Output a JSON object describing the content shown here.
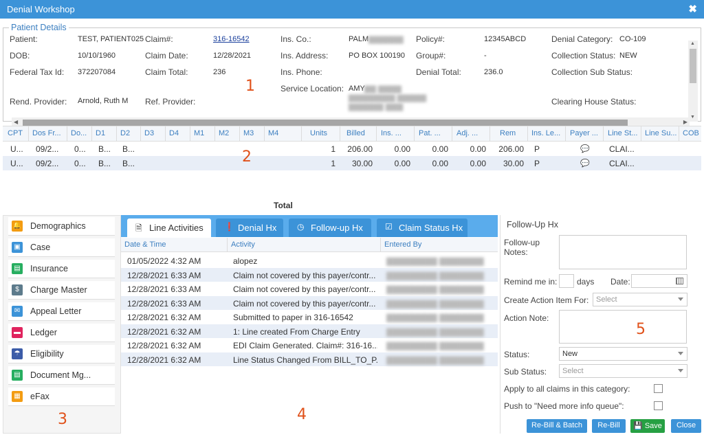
{
  "window": {
    "title": "Denial Workshop",
    "close_icon": "close-icon"
  },
  "markers": [
    "1",
    "2",
    "3",
    "4",
    "5"
  ],
  "patient_details": {
    "legend": "Patient Details",
    "labels": {
      "patient": "Patient:",
      "claim": "Claim#:",
      "ins_co": "Ins. Co.:",
      "policy": "Policy#:",
      "denial_category": "Denial Category:",
      "dob": "DOB:",
      "claim_date": "Claim Date:",
      "ins_address": "Ins. Address:",
      "group": "Group#:",
      "collection_status": "Collection Status:",
      "federal_tax_id": "Federal Tax Id:",
      "claim_total": "Claim Total:",
      "ins_phone": "Ins. Phone:",
      "denial_total": "Denial Total:",
      "collection_sub_status": "Collection Sub Status:",
      "service_location": "Service Location:",
      "rend_provider": "Rend. Provider:",
      "ref_provider": "Ref. Provider:",
      "clearing_house_status": "Clearing House Status:"
    },
    "values": {
      "patient": "TEST, PATIENT025",
      "claim": "316-16542",
      "ins_co": "PALM",
      "policy": "12345ABCD",
      "denial_category": "CO-109",
      "dob": "10/10/1960",
      "claim_date": "12/28/2021",
      "ins_address": "PO BOX 100190",
      "group": "-",
      "collection_status": "NEW",
      "federal_tax_id": "372207084",
      "claim_total": "236",
      "denial_total": "236.0",
      "service_location": "AMY",
      "rend_provider": "Arnold, Ruth M"
    }
  },
  "charge_grid": {
    "columns": [
      "CPT",
      "Dos Fr...",
      "Do...",
      "D1",
      "D2",
      "D3",
      "D4",
      "M1",
      "M2",
      "M3",
      "M4",
      "Units",
      "Billed",
      "Ins. ...",
      "Pat. ...",
      "Adj. ...",
      "Rem",
      "Ins. Le...",
      "Payer ...",
      "Line St...",
      "Line Su...",
      "COB"
    ],
    "rows": [
      {
        "cpt": "U...",
        "dos_from": "09/2...",
        "dos_to": "0...",
        "d1": "B...",
        "d2": "B...",
        "units": "1",
        "billed": "206.00",
        "ins": "0.00",
        "pat": "0.00",
        "adj": "0.00",
        "rem": "206.00",
        "ins_level": "P",
        "payer_icon": "comment-icon",
        "line_status": "CLAI..."
      },
      {
        "cpt": "U...",
        "dos_from": "09/2...",
        "dos_to": "0...",
        "d1": "B...",
        "d2": "B...",
        "units": "1",
        "billed": "30.00",
        "ins": "0.00",
        "pat": "0.00",
        "adj": "0.00",
        "rem": "30.00",
        "ins_level": "P",
        "payer_icon": "comment-icon",
        "line_status": "CLAI..."
      }
    ],
    "total_label": "Total"
  },
  "sidebar": {
    "items": [
      {
        "label": "Demographics",
        "icon": "bell-icon",
        "color": "#f39c12"
      },
      {
        "label": "Case",
        "icon": "case-icon",
        "color": "#3c93d8"
      },
      {
        "label": "Insurance",
        "icon": "id-card-icon",
        "color": "#27ae60"
      },
      {
        "label": "Charge Master",
        "icon": "dollar-icon",
        "color": "#5d7b8c"
      },
      {
        "label": "Appeal Letter",
        "icon": "envelope-icon",
        "color": "#3c93d8"
      },
      {
        "label": "Ledger",
        "icon": "ledger-icon",
        "color": "#e0245e"
      },
      {
        "label": "Eligibility",
        "icon": "umbrella-icon",
        "color": "#3c5ca8"
      },
      {
        "label": "Document Mg...",
        "icon": "document-icon",
        "color": "#27ae60"
      },
      {
        "label": "eFax",
        "icon": "fax-icon",
        "color": "#f39c12"
      }
    ]
  },
  "activity": {
    "tabs": [
      {
        "label": "Line Activities",
        "icon": "file-icon",
        "active": true
      },
      {
        "label": "Denial Hx",
        "icon": "alert-icon",
        "active": false
      },
      {
        "label": "Follow-up Hx",
        "icon": "clock-icon",
        "active": false
      },
      {
        "label": "Claim Status Hx",
        "icon": "check-square-icon",
        "active": false
      }
    ],
    "columns": [
      "Date & Time",
      "Activity",
      "Entered By"
    ],
    "rows": [
      {
        "datetime": "01/05/2022 4:32 AM",
        "activity": "alopez",
        "entered_by": ""
      },
      {
        "datetime": "12/28/2021 6:33 AM",
        "activity": "Claim not covered by this payer/contr...",
        "entered_by": ""
      },
      {
        "datetime": "12/28/2021 6:33 AM",
        "activity": "Claim not covered by this payer/contr...",
        "entered_by": ""
      },
      {
        "datetime": "12/28/2021 6:33 AM",
        "activity": "Claim not covered by this payer/contr...",
        "entered_by": ""
      },
      {
        "datetime": "12/28/2021 6:32 AM",
        "activity": "Submitted to paper in 316-16542",
        "entered_by": ""
      },
      {
        "datetime": "12/28/2021 6:32 AM",
        "activity": "1: Line created From Charge Entry",
        "entered_by": ""
      },
      {
        "datetime": "12/28/2021 6:32 AM",
        "activity": "EDI Claim Generated. Claim#: 316-16...",
        "entered_by": ""
      },
      {
        "datetime": "12/28/2021 6:32 AM",
        "activity": "Line Status Changed From BILL_TO_P...",
        "entered_by": ""
      }
    ]
  },
  "followup": {
    "title": "Follow-Up Hx",
    "notes_label": "Follow-up Notes:",
    "remind_label": "Remind me in:",
    "days_label": "days",
    "date_label": "Date:",
    "create_action_label": "Create Action Item For:",
    "create_action_placeholder": "Select",
    "action_note_label": "Action Note:",
    "status_label": "Status:",
    "status_value": "New",
    "sub_status_label": "Sub Status:",
    "sub_status_placeholder": "Select",
    "apply_all_label": "Apply to all claims in this category:",
    "push_label": "Push to \"Need more info queue\":",
    "buttons": {
      "rebill_batch": "Re-Bill & Batch",
      "rebill": "Re-Bill",
      "save": "Save",
      "close": "Close"
    }
  }
}
